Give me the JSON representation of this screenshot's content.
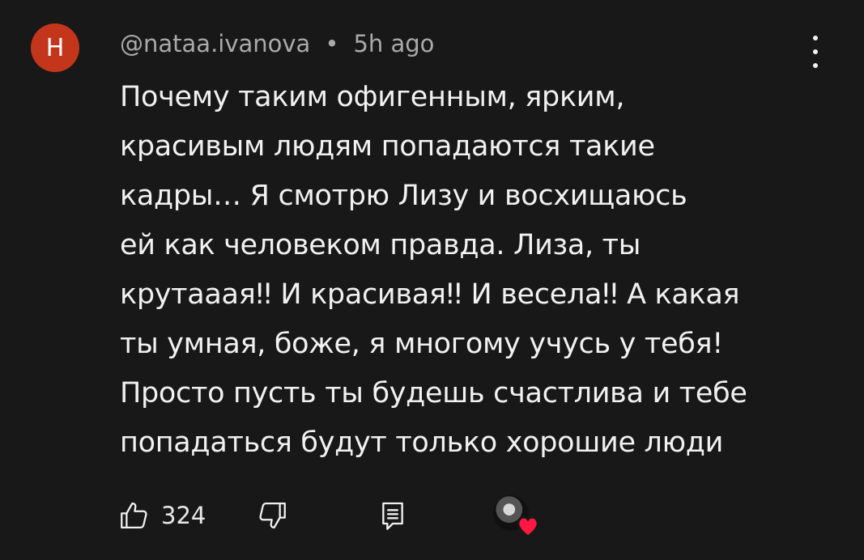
{
  "comment": {
    "avatar_letter": "H",
    "avatar_color": "#c4361b",
    "author": "@nataa.ivanova",
    "separator": "•",
    "time": "5h ago",
    "text_lines": [
      "Почему таким офигенным, ярким,",
      "красивым людям попадаются такие",
      "кадры… Я смотрю Лизу и восхищаюсь",
      "ей как человеком правда. Лиза, ты",
      "крутаааяǃǃ И красиваяǃǃ  И веселаǃǃ А какая",
      "ты умная, боже, я многому учусь у тебя!",
      "Просто пусть ты будешь счастлива и тебе",
      "попадаться будут только хорошие люди"
    ],
    "like_count": "324",
    "heart_color": "#ff1744"
  },
  "icons": {
    "menu": "more-vert-icon",
    "like": "thumb-up-icon",
    "dislike": "thumb-down-icon",
    "reply": "reply-icon",
    "creator_heart": "creator-heart-icon"
  }
}
